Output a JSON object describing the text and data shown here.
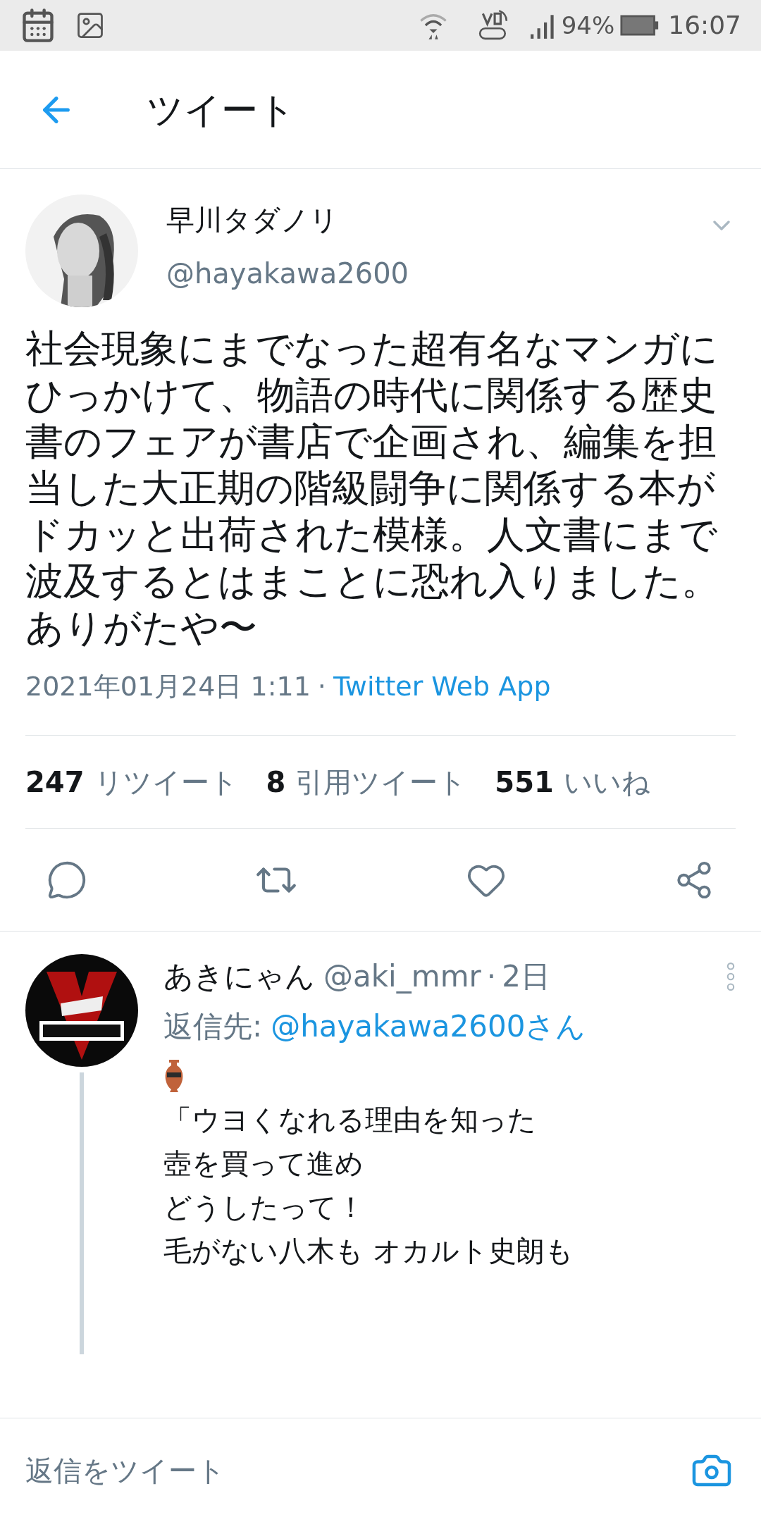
{
  "status_bar": {
    "battery": "94%",
    "time": "16:07"
  },
  "header": {
    "title": "ツイート"
  },
  "tweet": {
    "name": "早川タダノリ",
    "handle": "@hayakawa2600",
    "text": "社会現象にまでなった超有名なマンガにひっかけて、物語の時代に関係する歴史書のフェアが書店で企画され、編集を担当した大正期の階級闘争に関係する本がドカッと出荷された模様。人文書にまで波及するとはまことに恐れ入りました。ありがたや〜",
    "date": "2021年01月24日 1:11",
    "separator": "·",
    "source": "Twitter Web App"
  },
  "stats": [
    {
      "count": "247",
      "label": "リツイート"
    },
    {
      "count": "8",
      "label": "引用ツイート"
    },
    {
      "count": "551",
      "label": "いいね"
    }
  ],
  "reply": {
    "name": "あきにゃん",
    "handle": "@aki_mmr",
    "separator": "·",
    "time": "2日",
    "reply_to_label": "返信先:",
    "reply_to": "@hayakawa2600さん",
    "lines": [
      "「ウヨくなれる理由を知った",
      "壺を買って進め",
      "どうしたって！",
      "毛がない八木も オカルト史朗も"
    ]
  },
  "compose": {
    "placeholder": "返信をツイート"
  }
}
